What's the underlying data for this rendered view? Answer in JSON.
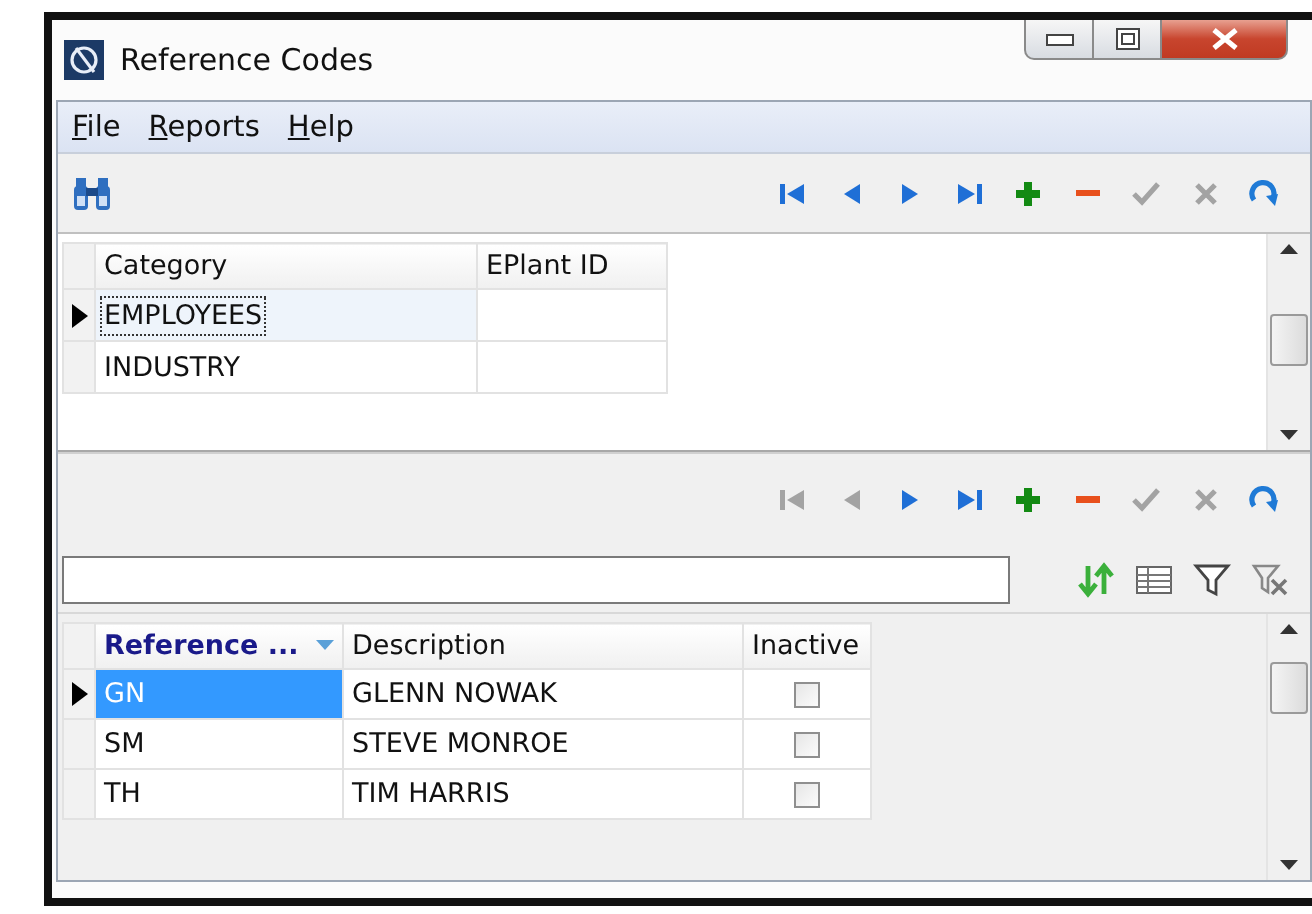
{
  "window": {
    "title": "Reference Codes"
  },
  "menu": [
    "File",
    "Reports",
    "Help"
  ],
  "master_navigator": [
    {
      "kind": "first",
      "disabled": false
    },
    {
      "kind": "prior",
      "disabled": false
    },
    {
      "kind": "next",
      "disabled": false
    },
    {
      "kind": "last",
      "disabled": false
    },
    {
      "kind": "insert",
      "disabled": false
    },
    {
      "kind": "delete",
      "disabled": false
    },
    {
      "kind": "post",
      "disabled": true
    },
    {
      "kind": "cancel",
      "disabled": true
    },
    {
      "kind": "refresh",
      "disabled": false
    }
  ],
  "master_grid": {
    "columns": [
      {
        "label": "Category"
      },
      {
        "label": "EPlant ID"
      }
    ],
    "rows": [
      {
        "cells": [
          "EMPLOYEES"
        ],
        "selected": true
      },
      {
        "cells": [
          "INDUSTRY"
        ],
        "selected": false
      }
    ]
  },
  "detail_navigator": [
    {
      "kind": "first",
      "disabled": true
    },
    {
      "kind": "prior",
      "disabled": true
    },
    {
      "kind": "next",
      "disabled": false
    },
    {
      "kind": "last",
      "disabled": false
    },
    {
      "kind": "insert",
      "disabled": false
    },
    {
      "kind": "delete",
      "disabled": false
    },
    {
      "kind": "post",
      "disabled": true
    },
    {
      "kind": "cancel",
      "disabled": true
    },
    {
      "kind": "refresh",
      "disabled": false
    }
  ],
  "detail_grid": {
    "columns": [
      {
        "label": "Reference ...",
        "kind": "text",
        "sorted": true
      },
      {
        "label": "Description",
        "kind": "text",
        "sorted": false
      },
      {
        "label": "Inactive",
        "kind": "checkbox",
        "sorted": false
      }
    ],
    "rows": [
      {
        "cells": [
          "GN",
          "GLENN NOWAK"
        ],
        "inactive": false,
        "selected": true
      },
      {
        "cells": [
          "SM",
          "STEVE MONROE"
        ],
        "inactive": false,
        "selected": false
      },
      {
        "cells": [
          "TH",
          "TIM HARRIS"
        ],
        "inactive": false,
        "selected": false
      }
    ]
  }
}
